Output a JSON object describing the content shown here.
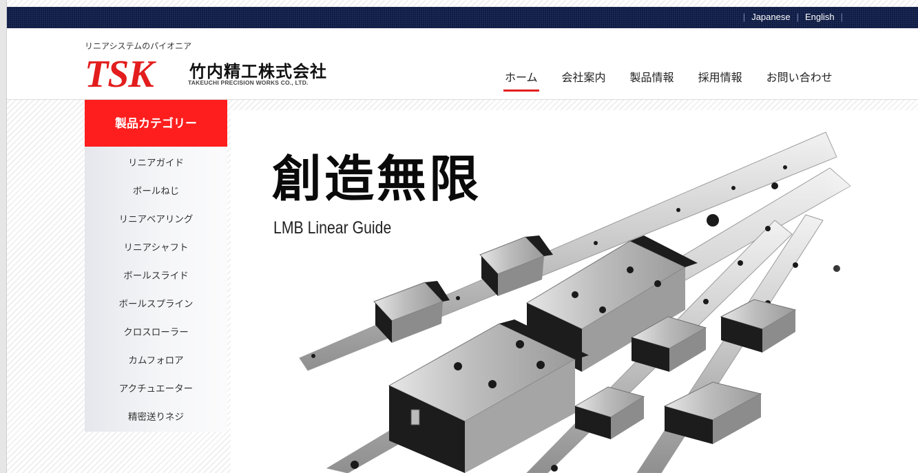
{
  "top_bar": {
    "languages": [
      "Japanese",
      "English"
    ]
  },
  "header": {
    "tagline": "リニアシステムのパイオニア",
    "logo_mark": "TSK",
    "company_jp": "竹内精工株式会社",
    "company_en": "TAKEUCHI PRECISION WORKS CO., LTD.",
    "nav": [
      "ホーム",
      "会社案内",
      "製品情報",
      "採用情報",
      "お問い合わせ"
    ]
  },
  "sidebar": {
    "title": "製品カテゴリー",
    "items": [
      "リニアガイド",
      "ボールねじ",
      "リニアベアリング",
      "リニアシャフト",
      "ボールスライド",
      "ボールスプライン",
      "クロスローラー",
      "カムフォロア",
      "アクチュエーター",
      "精密送りネジ"
    ]
  },
  "hero": {
    "title": "創造無限",
    "subtitle": "LMB Linear Guide"
  },
  "colors": {
    "brand_red": "#e31d1d",
    "top_bar": "#0d1a44",
    "category_header": "#ff1e1e"
  }
}
